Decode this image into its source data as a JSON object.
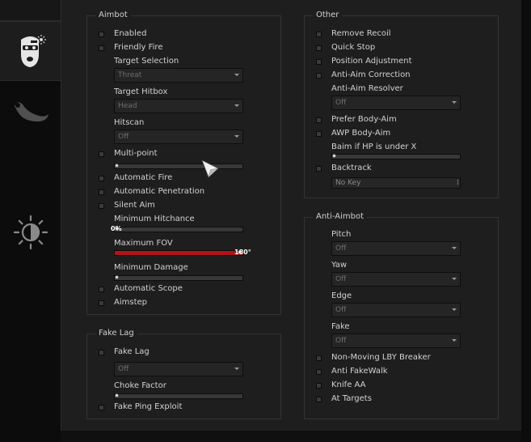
{
  "icons": {
    "tab_rage": "ski-mask-icon",
    "tab_legit": "karambit-knife-icon",
    "tab_visuals": "brightness-icon"
  },
  "colors": {
    "accent": "#b01414",
    "panel": "#1e1e1e",
    "sidebar": "#0c0c0c"
  },
  "aimbot": {
    "title": "Aimbot",
    "enabled": "Enabled",
    "friendly_fire": "Friendly Fire",
    "target_selection_label": "Target Selection",
    "target_selection_value": "Threat",
    "target_hitbox_label": "Target Hitbox",
    "target_hitbox_value": "Head",
    "hitscan_label": "Hitscan",
    "hitscan_value": "Off",
    "multipoint": "Multi-point",
    "multipoint_level": 0,
    "automatic_fire": "Automatic Fire",
    "automatic_penetration": "Automatic Penetration",
    "silent_aim": "Silent Aim",
    "min_hitchance_label": "Minimum Hitchance",
    "min_hitchance_value": "0%",
    "min_hitchance_level": 0,
    "max_fov_label": "Maximum FOV",
    "max_fov_value": "180°",
    "max_fov_level": 1,
    "min_damage_label": "Minimum Damage",
    "min_damage_level": 0,
    "automatic_scope": "Automatic Scope",
    "aimstep": "Aimstep"
  },
  "fakelag": {
    "title": "Fake Lag",
    "fake_lag": "Fake Lag",
    "mode_value": "Off",
    "choke_factor_label": "Choke Factor",
    "choke_factor_level": 0,
    "fake_ping": "Fake Ping Exploit"
  },
  "other": {
    "title": "Other",
    "remove_recoil": "Remove Recoil",
    "quick_stop": "Quick Stop",
    "position_adjustment": "Position Adjustment",
    "anti_aim_correction": "Anti-Aim Correction",
    "resolver_label": "Anti-Aim Resolver",
    "resolver_value": "Off",
    "prefer_body_aim": "Prefer Body-Aim",
    "awp_body_aim": "AWP Body-Aim",
    "baim_hp_label": "Baim if HP is under X",
    "baim_hp_level": 0,
    "backtrack": "Backtrack",
    "backtrack_key": "No Key"
  },
  "antiaim": {
    "title": "Anti-Aimbot",
    "pitch_label": "Pitch",
    "pitch_value": "Off",
    "yaw_label": "Yaw",
    "yaw_value": "Off",
    "edge_label": "Edge",
    "edge_value": "Off",
    "fake_label": "Fake",
    "fake_value": "Off",
    "lby_breaker": "Non-Moving LBY Breaker",
    "anti_fakewalk": "Anti FakeWalk",
    "knife_aa": "Knife AA",
    "at_targets": "At Targets"
  }
}
